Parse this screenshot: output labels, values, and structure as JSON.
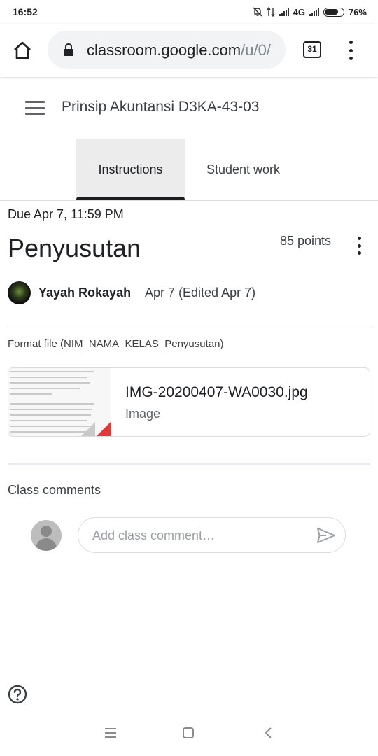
{
  "status_bar": {
    "time": "16:52",
    "network": "4G",
    "battery": "76%",
    "battery_level": 0.76
  },
  "browser": {
    "url_main": "classroom.google.com",
    "url_rest": "/u/0/",
    "tab_count": "31",
    "icons": [
      "home-icon",
      "lock-icon",
      "tab-switcher-icon",
      "more-vert-icon"
    ]
  },
  "header": {
    "class_name": "Prinsip Akuntansi D3KA-43-03"
  },
  "tabs": [
    {
      "label": "Instructions",
      "active": true
    },
    {
      "label": "Student work",
      "active": false
    }
  ],
  "assignment": {
    "due": "Due Apr 7, 11:59 PM",
    "title": "Penyusutan",
    "points": "85 points",
    "author": "Yayah Rokayah",
    "posted": "Apr 7 (Edited Apr 7)",
    "instructions": "Format file (NIM_NAMA_KELAS_Penyusutan)"
  },
  "attachment": {
    "name": "IMG-20200407-WA0030.jpg",
    "type": "Image"
  },
  "comments": {
    "title": "Class comments",
    "placeholder": "Add class comment…"
  },
  "colors": {
    "text_primary": "#202124",
    "text_secondary": "#5f6368",
    "active_tab_bg": "#ececed",
    "divider": "#dadce0"
  }
}
